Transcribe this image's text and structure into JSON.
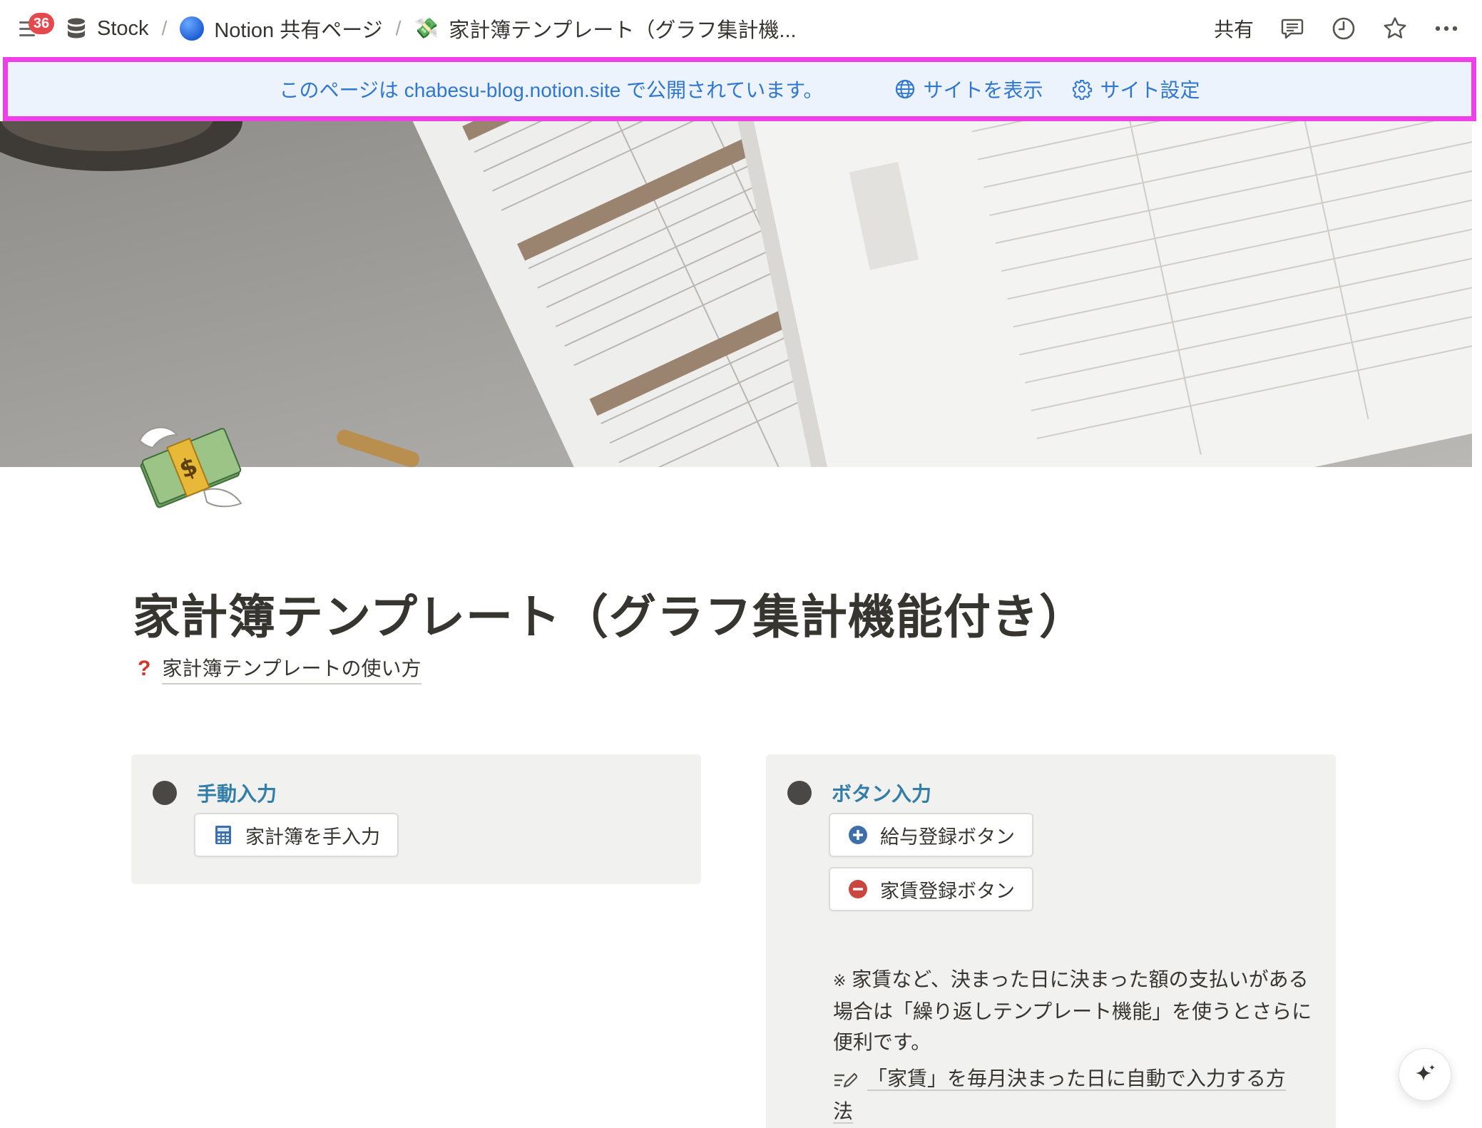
{
  "topbar": {
    "notification_count": "36",
    "breadcrumbs": [
      "Stock",
      "Notion 共有ページ",
      "家計簿テンプレート（グラフ集計機..."
    ],
    "separator": "/",
    "share_label": "共有"
  },
  "banner": {
    "message": "このページは chabesu-blog.notion.site で公開されています。",
    "view_site_label": "サイトを表示",
    "site_settings_label": "サイト設定"
  },
  "page": {
    "icon": "money-with-wings-icon",
    "title": "家計簿テンプレート（グラフ集計機能付き）",
    "howto_link": "家計簿テンプレートの使い方"
  },
  "cards": {
    "manual": {
      "title": "手動入力",
      "button_label": "家計簿を手入力"
    },
    "button_input": {
      "title": "ボタン入力",
      "salary_button_label": "給与登録ボタン",
      "rent_button_label": "家賃登録ボタン",
      "note_mark": "※",
      "note_text": "家賃など、決まった日に決まった額の支払いがある場合は「繰り返しテンプレート機能」を使うとさらに便利です。",
      "note_link": "「家賃」を毎月決まった日に自動で入力する方法"
    }
  },
  "colors": {
    "banner_text": "#2f77d1",
    "banner_bg": "#edf3fc",
    "highlight_border": "#ee3fe9",
    "card_title": "#337ea9",
    "badge": "#e5484d"
  }
}
